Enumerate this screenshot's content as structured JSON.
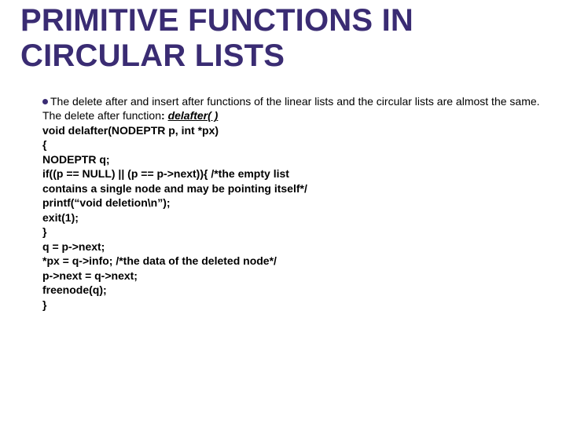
{
  "title": "PRIMITIVE FUNCTIONS IN CIRCULAR LISTS",
  "intro_part1": "The delete after and insert after functions of the linear lists and the circular lists are almost the same.",
  "intro_part2_a": "The delete after function",
  "intro_part2_b": ": ",
  "intro_part2_c": "delafter( )",
  "lines": {
    "l1": "void delafter(NODEPTR p, int *px)",
    "l2": "{",
    "l3": "NODEPTR q;",
    "l4": "if((p == NULL) || (p == p->next)){ /*the empty list",
    "l5": "contains a single node and may be pointing itself*/",
    "l6": "printf(“void deletion\\n”);",
    "l7": "exit(1);",
    "l8": "}",
    "l9": "q = p->next;",
    "l10": "*px = q->info; /*the data of the deleted node*/",
    "l11": "p->next = q->next;",
    "l12": "freenode(q);",
    "l13": "}"
  }
}
